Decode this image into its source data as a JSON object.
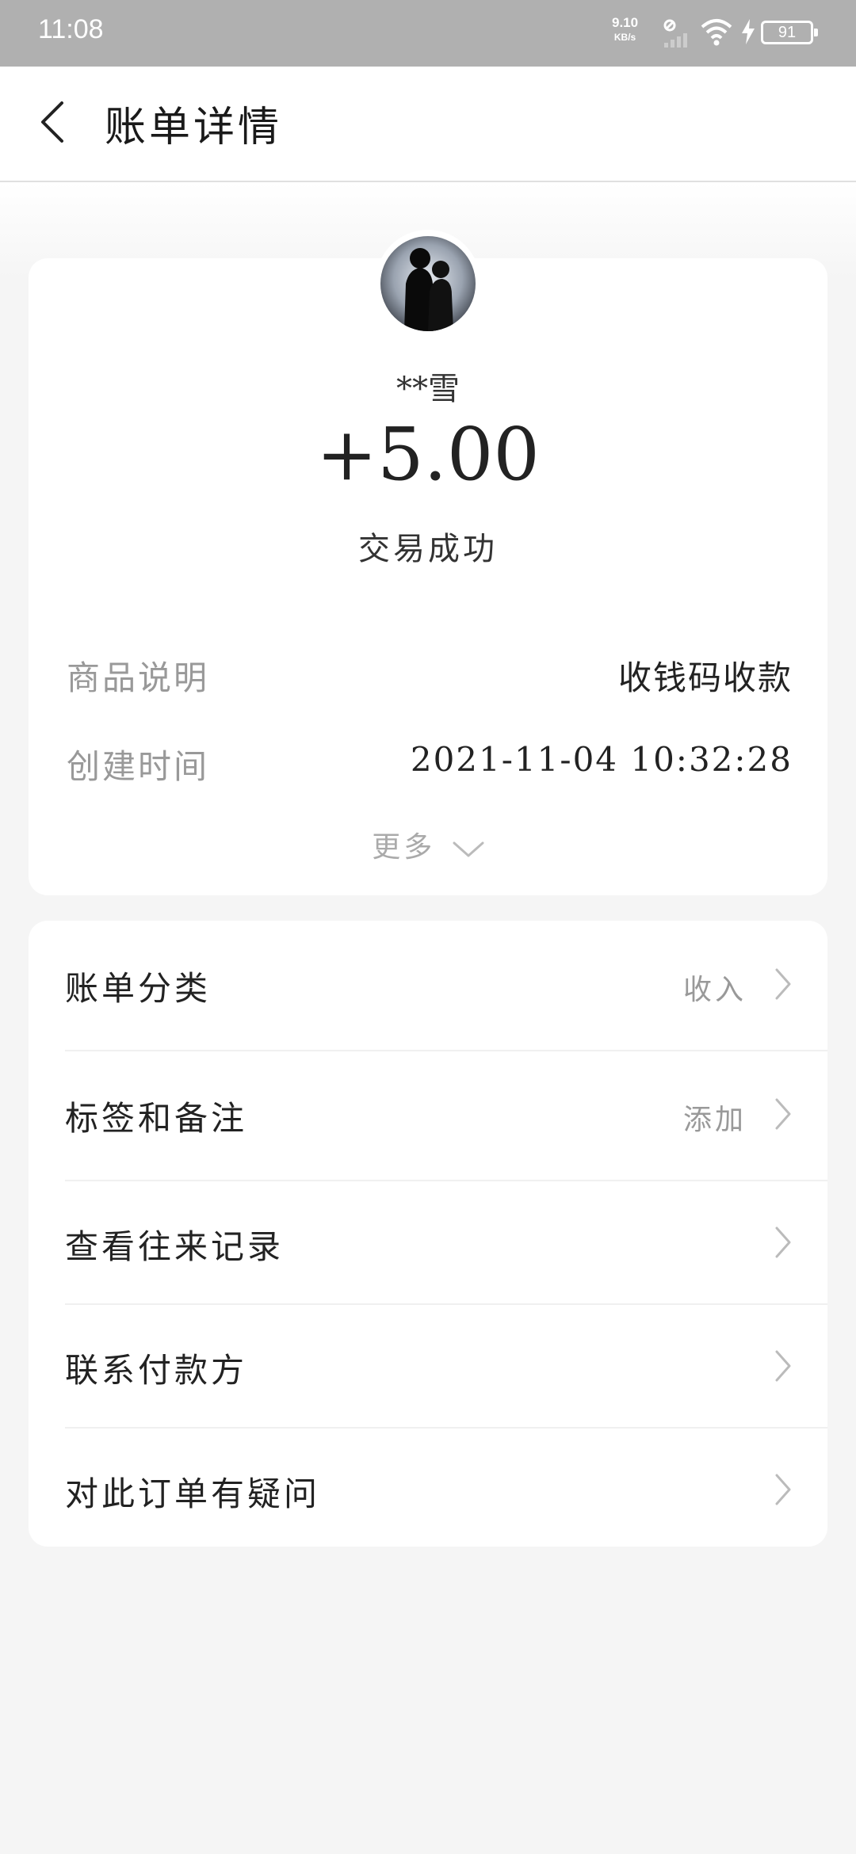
{
  "status_bar": {
    "time": "11:08",
    "net_speed": "9.10",
    "net_unit": "KB/s",
    "battery": "91"
  },
  "header": {
    "title": "账单详情"
  },
  "transaction": {
    "payer_name": "**雪",
    "amount": "+5.00",
    "status": "交易成功",
    "details": [
      {
        "label": "商品说明",
        "value": "收钱码收款"
      },
      {
        "label": "创建时间",
        "value": "2021-11-04 10:32:28"
      }
    ],
    "more_label": "更多"
  },
  "menu": [
    {
      "label": "账单分类",
      "value": "收入"
    },
    {
      "label": "标签和备注",
      "value": "添加"
    },
    {
      "label": "查看往来记录",
      "value": ""
    },
    {
      "label": "联系付款方",
      "value": ""
    },
    {
      "label": "对此订单有疑问",
      "value": ""
    }
  ],
  "colors": {
    "status_bar_bg": "#b0b0b0",
    "page_bg": "#f5f5f5",
    "card_bg": "#ffffff",
    "secondary_text": "#999999"
  }
}
